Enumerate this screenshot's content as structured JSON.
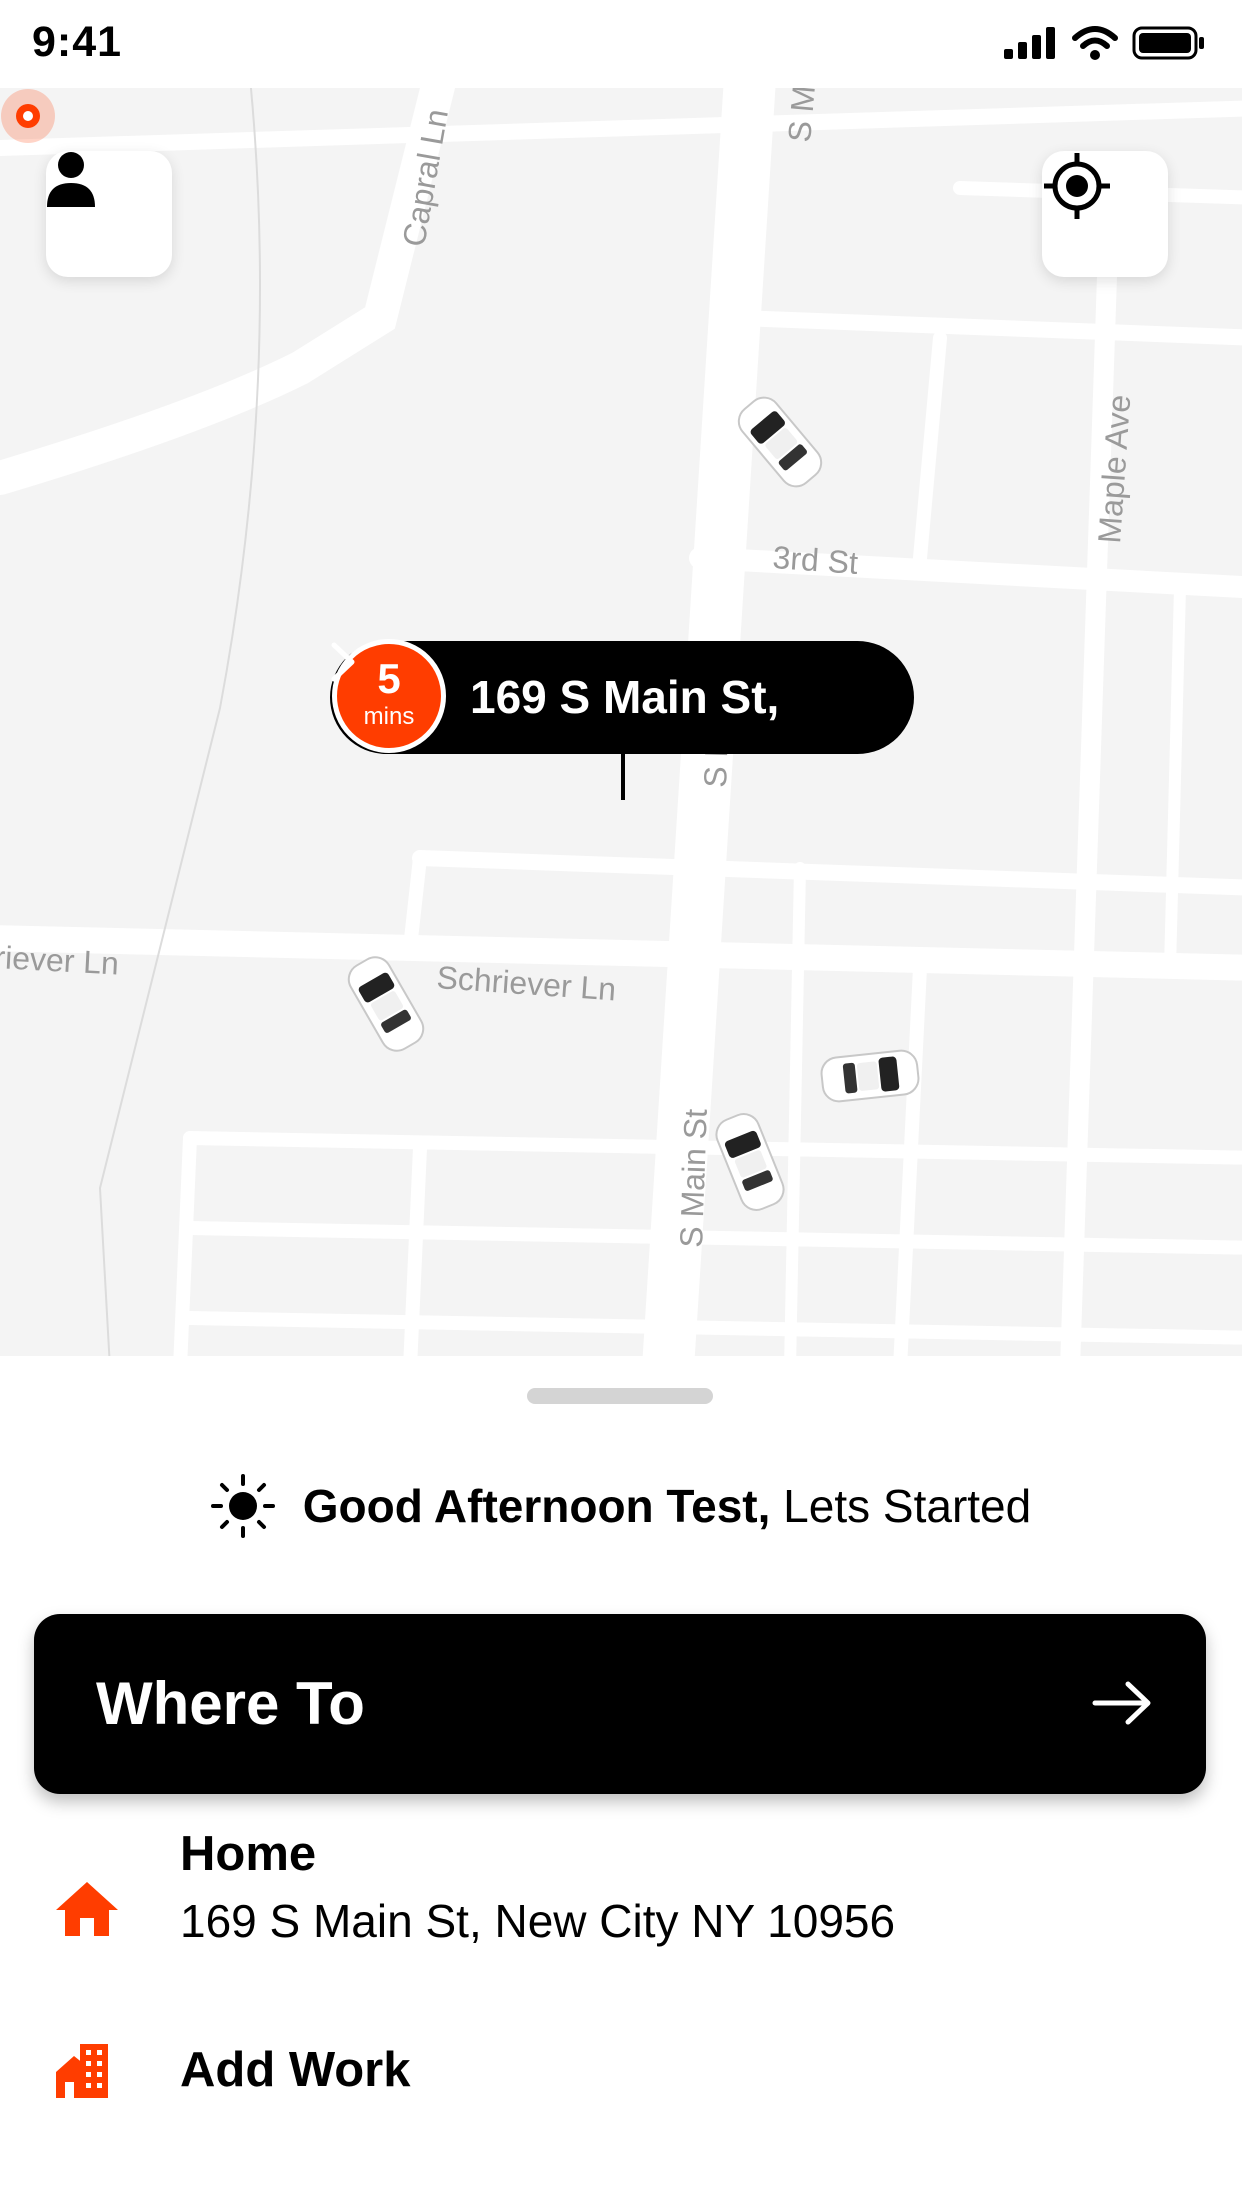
{
  "status_bar": {
    "time": "9:41"
  },
  "map": {
    "street_labels": [
      "Capral Ln",
      "S M",
      "Maple Ave",
      "3rd St",
      "S Main St",
      "Schriever Ln",
      "riever Ln",
      "S Main St"
    ],
    "pickup": {
      "eta_value": "5",
      "eta_unit": "mins",
      "address": "169 S Main St,"
    },
    "accent_color": "#ff3d00"
  },
  "sheet": {
    "greeting_bold": "Good Afternoon Test,",
    "greeting_rest": "Lets Started",
    "where_to_label": "Where To",
    "places": [
      {
        "icon": "home-icon",
        "title": "Home",
        "subtitle": "169 S Main St, New City NY 10956"
      },
      {
        "icon": "building-icon",
        "title": "Add Work"
      }
    ]
  }
}
